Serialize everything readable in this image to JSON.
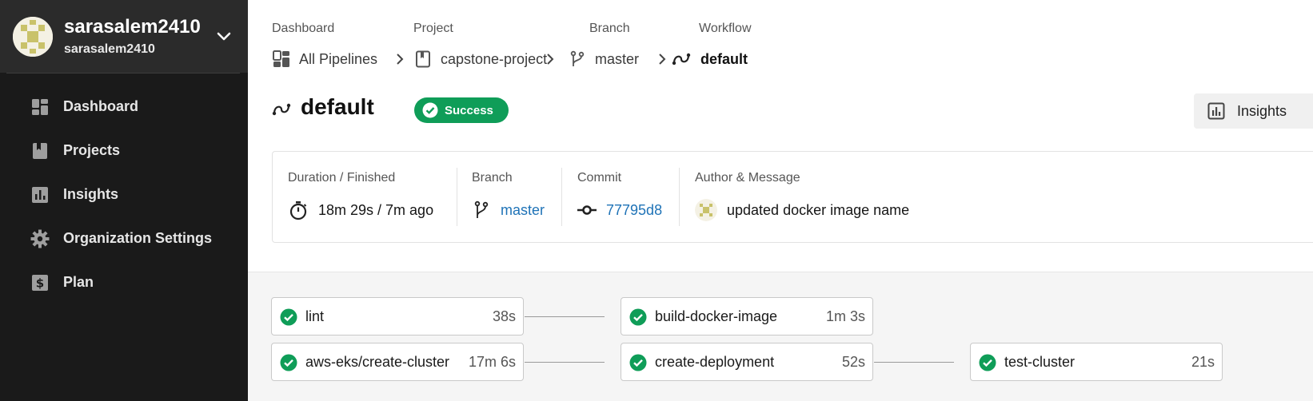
{
  "sidebar": {
    "org": {
      "name": "sarasalem2410",
      "sub": "sarasalem2410"
    },
    "items": [
      {
        "label": "Dashboard",
        "icon": "dashboard-icon"
      },
      {
        "label": "Projects",
        "icon": "book-icon"
      },
      {
        "label": "Insights",
        "icon": "bar-chart-icon"
      },
      {
        "label": "Organization Settings",
        "icon": "gear-icon"
      },
      {
        "label": "Plan",
        "icon": "dollar-icon"
      }
    ]
  },
  "breadcrumb": [
    {
      "label": "Dashboard",
      "value": "All Pipelines"
    },
    {
      "label": "Project",
      "value": "capstone-project"
    },
    {
      "label": "Branch",
      "value": "master"
    },
    {
      "label": "Workflow",
      "value": "default"
    }
  ],
  "header": {
    "title": "default",
    "status": "Success",
    "insights_label": "Insights"
  },
  "summary": {
    "duration_label": "Duration / Finished",
    "duration_value": "18m 29s / 7m ago",
    "branch_label": "Branch",
    "branch_value": "master",
    "commit_label": "Commit",
    "commit_value": "77795d8",
    "author_label": "Author & Message",
    "author_message": "updated docker image name"
  },
  "jobs": [
    {
      "name": "lint",
      "duration": "38s",
      "status": "success"
    },
    {
      "name": "aws-eks/create-cluster",
      "duration": "17m 6s",
      "status": "success"
    },
    {
      "name": "build-docker-image",
      "duration": "1m 3s",
      "status": "success"
    },
    {
      "name": "create-deployment",
      "duration": "52s",
      "status": "success"
    },
    {
      "name": "test-cluster",
      "duration": "21s",
      "status": "success"
    }
  ],
  "colors": {
    "sidebar_bg": "#1a1a1a",
    "success": "#0f9d58",
    "link": "#1f73b7"
  }
}
